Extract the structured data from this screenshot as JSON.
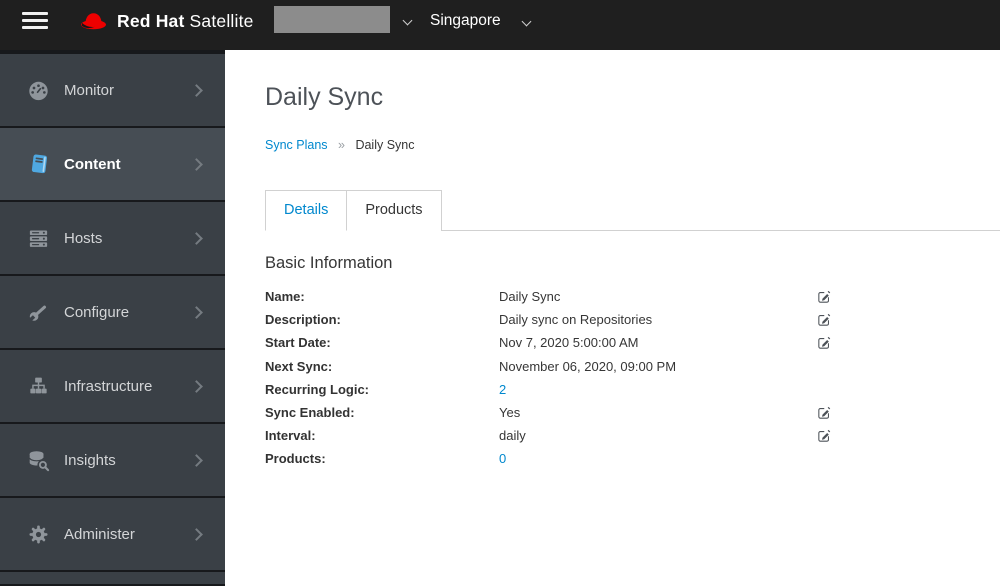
{
  "masthead": {
    "brand_bold": "Red Hat",
    "brand_product": "Satellite",
    "organization_dropdown": {
      "value": "",
      "redacted": true
    },
    "location": "Singapore"
  },
  "sidebar": {
    "items": [
      {
        "label": "Monitor",
        "icon": "tachometer-icon",
        "active": false
      },
      {
        "label": "Content",
        "icon": "book-icon",
        "active": true
      },
      {
        "label": "Hosts",
        "icon": "server-icon",
        "active": false
      },
      {
        "label": "Configure",
        "icon": "wrench-icon",
        "active": false
      },
      {
        "label": "Infrastructure",
        "icon": "sitemap-icon",
        "active": false
      },
      {
        "label": "Insights",
        "icon": "database-search-icon",
        "active": false
      },
      {
        "label": "Administer",
        "icon": "gear-icon",
        "active": false
      }
    ]
  },
  "main": {
    "title": "Daily Sync",
    "breadcrumb": {
      "link": "Sync Plans",
      "separator": "»",
      "current": "Daily Sync"
    },
    "tabs": [
      {
        "label": "Details",
        "active": true
      },
      {
        "label": "Products",
        "active": false
      }
    ],
    "section_title": "Basic Information",
    "info_rows": [
      {
        "label": "Name:",
        "value": "Daily Sync",
        "editable": true,
        "link": false
      },
      {
        "label": "Description:",
        "value": "Daily sync on Repositories",
        "editable": true,
        "link": false
      },
      {
        "label": "Start Date:",
        "value": "Nov 7, 2020 5:00:00 AM",
        "editable": true,
        "link": false
      },
      {
        "label": "Next Sync:",
        "value": "November 06, 2020, 09:00 PM",
        "editable": false,
        "link": false
      },
      {
        "label": "Recurring Logic:",
        "value": "2",
        "editable": false,
        "link": true
      },
      {
        "label": "Sync Enabled:",
        "value": "Yes",
        "editable": true,
        "link": false
      },
      {
        "label": "Interval:",
        "value": "daily",
        "editable": true,
        "link": false
      },
      {
        "label": "Products:",
        "value": "0",
        "editable": false,
        "link": true
      }
    ]
  },
  "colors": {
    "accent": "#0088ce",
    "masthead_bg": "#1f1f1f",
    "sidebar_bg": "#3a4046",
    "sidebar_active_bg": "#464d54",
    "sidebar_separator": "#17191c",
    "icon_blue": "#4fa8e1",
    "brand_red": "#ee0000",
    "border": "#d1d1d1",
    "title": "#4d5258",
    "text": "#363636",
    "redacted_box": "#8c8c8c"
  }
}
